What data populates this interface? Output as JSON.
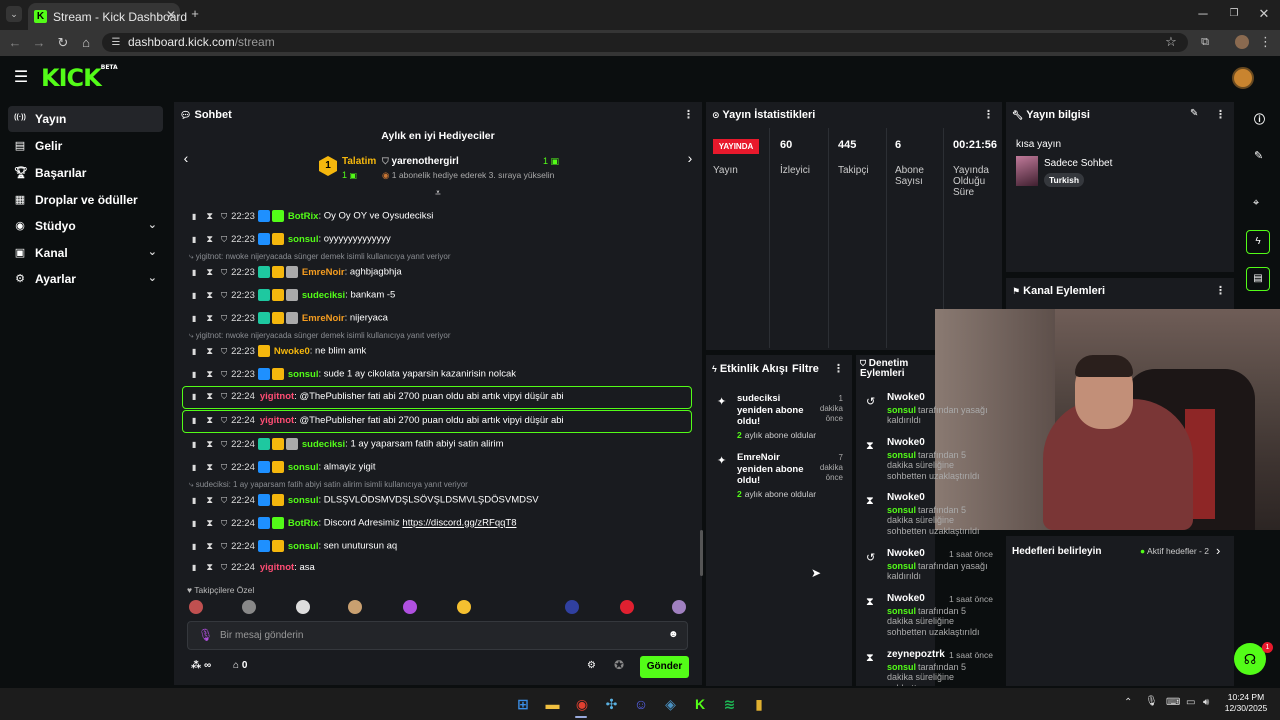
{
  "browser": {
    "tab_title": "Stream - Kick Dashboard",
    "url_domain": "dashboard.kick.com",
    "url_path": "/stream",
    "favicon_letter": "K"
  },
  "app": {
    "logo": "KICK",
    "logo_badge": "BETA"
  },
  "sidebar": {
    "items": [
      {
        "label": "Yayın",
        "icon": "broadcast-icon",
        "active": true
      },
      {
        "label": "Gelir",
        "icon": "revenue-icon"
      },
      {
        "label": "Başarılar",
        "icon": "trophy-icon"
      },
      {
        "label": "Droplar ve ödüller",
        "icon": "gift-icon"
      },
      {
        "label": "Stüdyo",
        "icon": "camera-icon",
        "expandable": true
      },
      {
        "label": "Kanal",
        "icon": "channel-icon",
        "expandable": true
      },
      {
        "label": "Ayarlar",
        "icon": "gear-icon",
        "expandable": true
      }
    ]
  },
  "chat": {
    "title": "Sohbet",
    "gifters_title": "Aylık en iyi Hediyeciler",
    "gifter1_name": "Talatim",
    "gifter1_count": "1",
    "gifter1_rank": "1",
    "gifter2_name": "yarenothergirl",
    "gifter2_count": "1",
    "gifter2_note": "1 abonelik hediye ederek 3. sıraya yükselin",
    "messages": [
      {
        "time": "22:23",
        "user": "BotRix",
        "text": ": Oy Oy OY ve Oysudeciksi"
      },
      {
        "time": "22:23",
        "user": "sonsul",
        "text": ": oyyyyyyyyyyyyy"
      },
      {
        "time": "22:23",
        "user": "EmreNoir",
        "text": ": aghbjagbhja"
      },
      {
        "time": "22:23",
        "user": "sudeciksi",
        "text": ": bankam -5"
      },
      {
        "time": "22:23",
        "user": "EmreNoir",
        "text": ": nijeryaca"
      },
      {
        "time": "22:23",
        "user": "Nwoke0",
        "text": ": ne blim amk"
      },
      {
        "time": "22:23",
        "user": "sonsul",
        "text": ": sude 1 ay cikolata yaparsin kazanirisin nolcak"
      },
      {
        "time": "22:24",
        "user": "yigitnot",
        "text": ": @ThePublisher fati abi 2700 puan oldu abi artık vipyi düşür abi"
      },
      {
        "time": "22:24",
        "user": "yigitnot",
        "text": ": @ThePublisher fati abi 2700 puan oldu abi artık vipyi düşür abi"
      },
      {
        "time": "22:24",
        "user": "sudeciksi",
        "text": ": 1 ay yaparsam fatih abiyi satin alirim"
      },
      {
        "time": "22:24",
        "user": "sonsul",
        "text": ": almayiz yigit"
      },
      {
        "time": "22:24",
        "user": "sonsul",
        "text": ": DLSŞVLÖDSMVDŞLSÖVŞLDSMVLŞDÖSVMDSV"
      },
      {
        "time": "22:24",
        "user": "BotRix",
        "text": ": Discord Adresimiz ",
        "link": "https://discord.gg/zRFqqT8"
      },
      {
        "time": "22:24",
        "user": "sonsul",
        "text": ": sen unutursun aq"
      },
      {
        "time": "22:24",
        "user": "yigitnot",
        "text": ": asa"
      }
    ],
    "replies": [
      "yigitnot: nwoke nijeryacada sünger demek isimli kullanıcıya yanıt veriyor",
      "yigitnot: nwoke nijeryacada sünger demek isimli kullanıcıya yanıt veriyor",
      "sudeciksi: 1 ay yaparsam fatih abiyi satin alirim isimli kullanıcıya yanıt veriyor"
    ],
    "followers_label": "Takipçilere Özel",
    "input_placeholder": "Bir mesaj gönderin",
    "points": "∞",
    "store_count": "0",
    "send_label": "Gönder"
  },
  "stats": {
    "title": "Yayın İstatistikleri",
    "live_label": "YAYINDA",
    "live_sub": "Yayın",
    "viewers": "60",
    "viewers_label": "İzleyici",
    "followers": "445",
    "followers_label": "Takipçi",
    "subs": "6",
    "subs_label": "Abone Sayısı",
    "duration": "00:21:56",
    "duration_label": "Yayında Olduğu Süre"
  },
  "info": {
    "title": "Yayın bilgisi",
    "stream_title": "kısa yayın",
    "category": "Sadece Sohbet",
    "language": "Turkish"
  },
  "actions": {
    "title": "Kanal Eylemleri"
  },
  "goals": {
    "title": "Hedefleri belirleyin",
    "active": "Aktif hedefler - 2"
  },
  "activity": {
    "title": "Etkinlik Akışı",
    "filter": "Filtre",
    "events": [
      {
        "name": "sudeciksi",
        "line1": "yeniden abone",
        "line2": "oldu!",
        "ago": "1 dakika önce",
        "months": "2",
        "months_text": "aylık abone oldular"
      },
      {
        "name": "EmreNoir",
        "line1": "yeniden abone",
        "line2": "oldu!",
        "ago": "7 dakika önce",
        "months": "2",
        "months_text": "aylık abone oldular"
      }
    ]
  },
  "moderation": {
    "title": "Denetim Eylemleri",
    "items": [
      {
        "user": "Nwoke0",
        "mod": "sonsul",
        "text": "tarafından yasağı kaldırıldı",
        "time": ""
      },
      {
        "user": "Nwoke0",
        "mod": "sonsul",
        "text": "tarafından 5 dakika süreliğine sohbetten uzaklaştırıldı",
        "time": ""
      },
      {
        "user": "Nwoke0",
        "mod": "sonsul",
        "text": "tarafından 5 dakika süreliğine sohbetten uzaklaştırıldı",
        "time": ""
      },
      {
        "user": "Nwoke0",
        "mod": "sonsul",
        "text": "tarafından yasağı kaldırıldı",
        "time": "1 saat önce"
      },
      {
        "user": "Nwoke0",
        "mod": "sonsul",
        "text": "tarafından 5 dakika süreliğine sohbetten uzaklaştırıldı",
        "time": "1 saat önce"
      },
      {
        "user": "zeynepoztrk",
        "mod": "sonsul",
        "text": "tarafından 5 dakika süreliğine sohbetten",
        "time": "1 saat önce"
      }
    ]
  },
  "support_badge": "1",
  "taskbar": {
    "time": "10:24 PM",
    "date": "12/30/2025"
  },
  "colors": {
    "accent": "#53fc18",
    "live": "#e8192c",
    "panel": "#191b1f",
    "bg": "#0b0e0f"
  }
}
